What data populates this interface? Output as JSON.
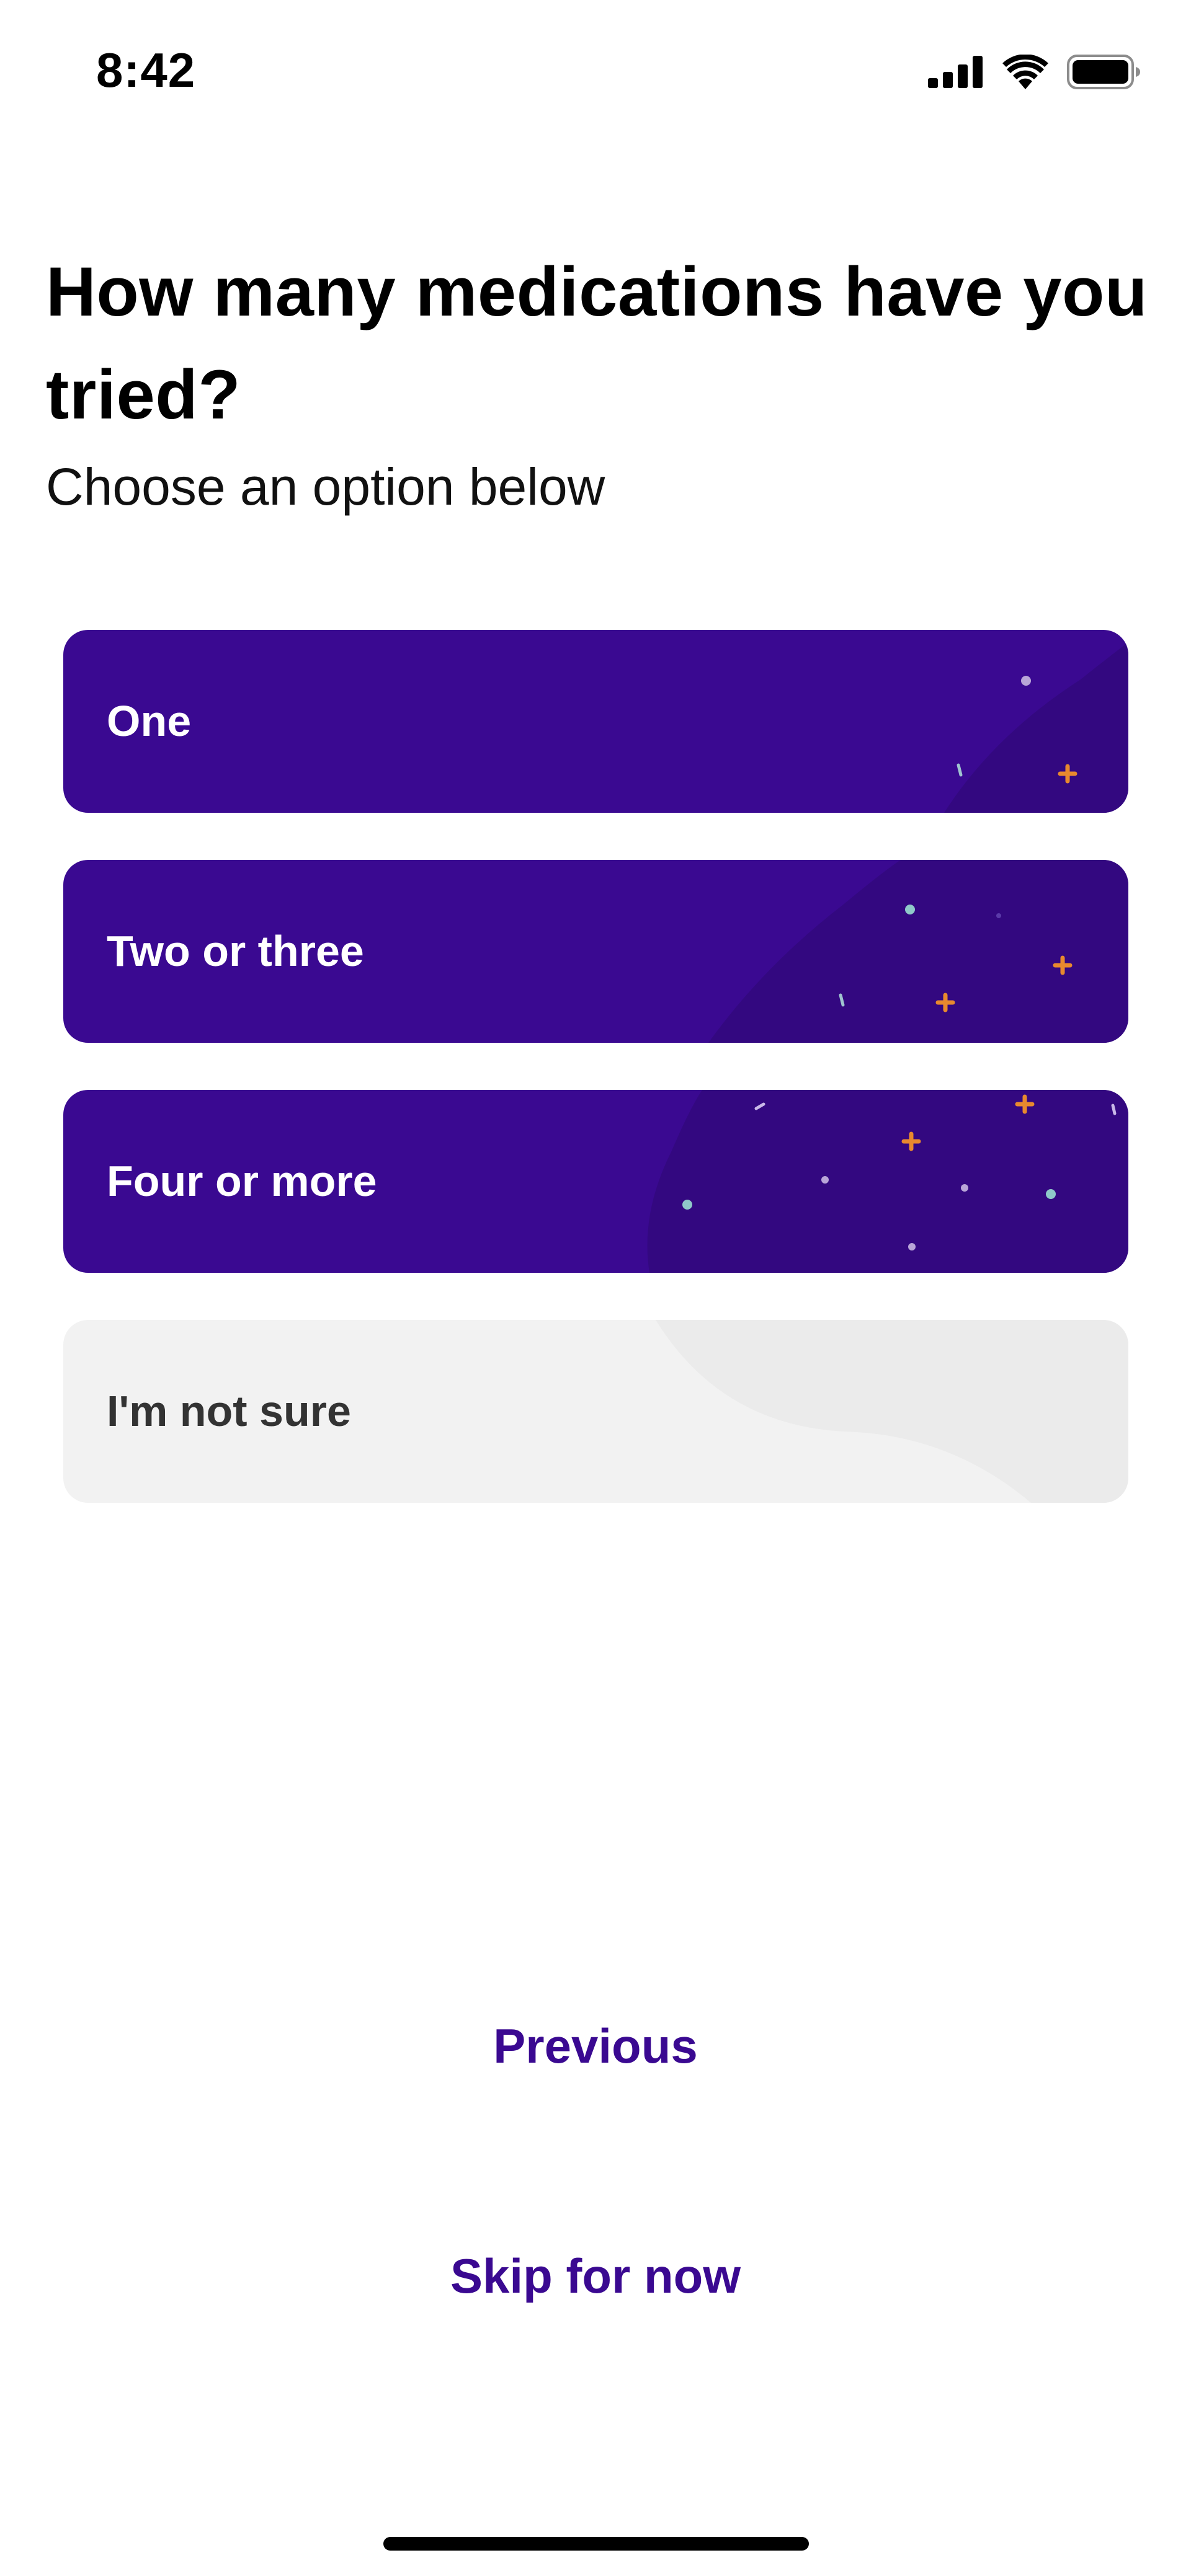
{
  "status_bar": {
    "time": "8:42",
    "icons": [
      "cellular-signal-icon",
      "wifi-icon",
      "battery-icon"
    ]
  },
  "question": {
    "title": "How many medications have you tried?",
    "subtitle": "Choose an option below"
  },
  "options": [
    {
      "label": "One",
      "selected": true
    },
    {
      "label": "Two or three",
      "selected": true
    },
    {
      "label": "Four or more",
      "selected": true
    },
    {
      "label": "I'm not sure",
      "selected": false
    }
  ],
  "navigation": {
    "previous_label": "Previous",
    "skip_label": "Skip for now"
  },
  "colors": {
    "accent": "#3a0991",
    "selected_option_bg": "#3a0991",
    "unselected_option_bg": "#f2f2f2",
    "confetti_orange": "#e8892e",
    "confetti_teal": "#8fc9c9"
  }
}
